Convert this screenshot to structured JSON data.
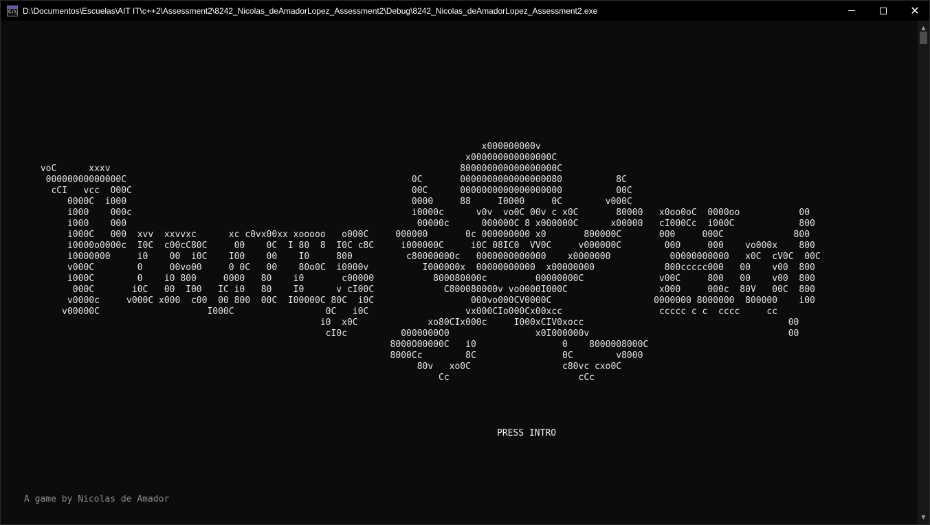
{
  "window": {
    "title": "D:\\Documentos\\Escuelas\\AIT IT\\c++2\\Assessment2\\8242_Nicolas_deAmadorLopez_Assessment2\\Debug\\8242_Nicolas_deAmadorLopez_Assessment2.exe",
    "icon": "console-app-icon",
    "icon_text": "C:\\",
    "controls": {
      "minimize": "minimize-icon",
      "maximize": "maximize-icon",
      "close_glyph": "✕"
    }
  },
  "console": {
    "ascii_art": "                                                                                   x000000000v\n                                                                                x000000000000000C\n voC      xxxv                                                                 800000000000000000C\n  00000000000000C                                                     0C       0000000000000000080          8C\n   cCI   vcc  O00C                                                    00C      0000000000000000000          00C\n      0000C  i000                                                     0000     88     I0000     0C        v000C\n      i000    000c                                                    i0000c      v0v  vo0C 00v c x0C       80000   x0oo0oC  0000oo           00\n      i000    000                                                      00000c      000000C 8 x000000C      x00000   cI000Cc  i000C            800\n      i000C   000  xvv  xxvvxc      xc c0vx00xx xooooo   o000C     000000       0c 000000000 x0       800000C       000     000C             800\n      i0000o0000c  I0C  c00cC80C     00    0C  I 80  8  I0C c8C     i000000C     i0C 08IC0  VV0C     v000000C        000     000    vo000x    800\n      i0000000     i0    00  i0C    I00    00    I0     800          c80000000c   0000000000000    x0000000           00000000000   x0C  cV0C  00C\n      v000C        0     00vo00     0 0C   00    80o0C  i0000v          I000000x  00000000000  x00000000             800ccccc000   00    v00  800\n      i000C        0    i0 800     0000   80    i0       c00000           800080000c         00000000C              v00C     800   00    v00  800\n       000C       i0C   00  I00   IC i0   80    I0      v cI00C             C800080000v vo0000I000C                 x000     000c  80V   00C  800\n      v0000c     v000C x000  c00  00 800  00C  I00000C 80C  i0C                  000vo000CV0000C                   0000000 8000000  800000    i00\n     v00000C                    I000C                 0C   i0C                  vx000CIo000Cx00xcc                  ccccc c c  cccc     cc\n                                                     i0  x0C             xo80CIx000c     I000xCIV0xocc                                      00\n                                                      cI0c          0000000O0                x0I000000v                                     00\n                                                                  8000O00000C   i0                0    8000008000C\n                                                                  8000Cc        8C                0C        v8000\n                                                                       80v   xo0C                 c80vc cxo0C\n                                                                           Cc                        cCc",
    "prompt": "PRESS INTRO",
    "credits": "A game by Nicolas de Amador"
  },
  "scrollbar": {
    "up_arrow": "▲",
    "down_arrow": "▼"
  }
}
